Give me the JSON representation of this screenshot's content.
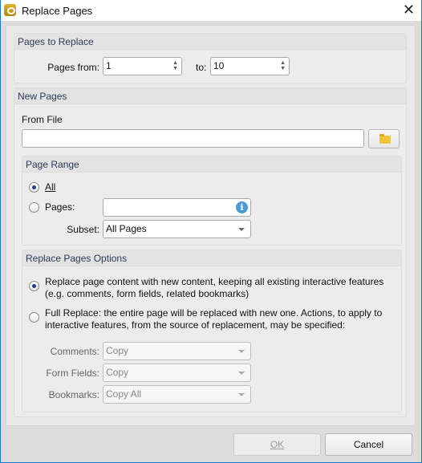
{
  "window": {
    "title": "Replace Pages",
    "close": "✕"
  },
  "pages_to_replace": {
    "header": "Pages to Replace",
    "from_label": "Pages from:",
    "from_value": "1",
    "to_label": "to:",
    "to_value": "10"
  },
  "new_pages": {
    "header": "New Pages",
    "from_file_label": "From File",
    "file_value": "",
    "page_range": {
      "header": "Page Range",
      "all_label": "All",
      "pages_label": "Pages:",
      "pages_value": "",
      "subset_label": "Subset:",
      "subset_value": "All Pages",
      "selected": "All"
    },
    "options": {
      "header": "Replace Pages Options",
      "option1": [
        "Replace page content with new content, keeping all existing interactive features",
        "(e.g. comments, form fields, related bookmarks)"
      ],
      "option2": [
        "Full Replace: the entire page will be replaced with new one. Actions, to apply to",
        "interactive features, from the source of replacement, may be specified:"
      ],
      "selected": "option1",
      "comments_label": "Comments:",
      "comments_value": "Copy",
      "form_fields_label": "Form Fields:",
      "form_fields_value": "Copy",
      "bookmarks_label": "Bookmarks:",
      "bookmarks_value": "Copy All"
    }
  },
  "buttons": {
    "ok": "OK",
    "cancel": "Cancel"
  }
}
